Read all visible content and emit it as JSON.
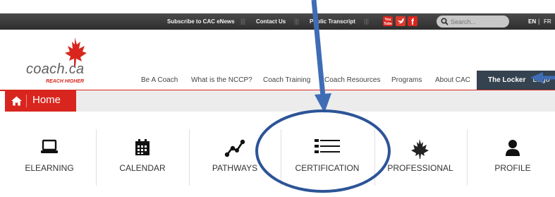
{
  "topbar": {
    "links": [
      {
        "label": "Subscribe to CAC eNews"
      },
      {
        "label": "Contact Us"
      },
      {
        "label": "Public Transcript"
      }
    ],
    "social": [
      {
        "icon": "youtube-icon",
        "line1": "You",
        "line2": "Tube"
      },
      {
        "icon": "twitter-icon",
        "glyph": "♥"
      },
      {
        "icon": "facebook-icon",
        "glyph": "f"
      }
    ],
    "search_placeholder": "Search...",
    "lang": {
      "en": "EN",
      "separator": "|",
      "fr": "FR"
    }
  },
  "logo": {
    "text": "coach.ca",
    "tagline": "REACH HIGHER"
  },
  "nav": {
    "items": [
      "Be A Coach",
      "What is the NCCP?",
      "Coach Training",
      "Coach Resources",
      "Programs",
      "About CAC"
    ],
    "locker": "The Locker",
    "locker_extra": "Logo"
  },
  "home": {
    "label": "Home"
  },
  "menu": [
    {
      "label": "ELEARNING",
      "icon": "laptop-icon"
    },
    {
      "label": "CALENDAR",
      "icon": "calendar-icon"
    },
    {
      "label": "PATHWAYS",
      "icon": "pathways-icon"
    },
    {
      "label": "CERTIFICATION",
      "icon": "certification-icon"
    },
    {
      "label": "PROFESSIONAL",
      "icon": "maple-leaf-icon"
    },
    {
      "label": "PROFILE",
      "icon": "user-icon"
    }
  ],
  "colors": {
    "brand_red": "#d8261f",
    "topbar": "#3a3a3a",
    "locker": "#35424f",
    "annotation": "#3f6db5"
  }
}
